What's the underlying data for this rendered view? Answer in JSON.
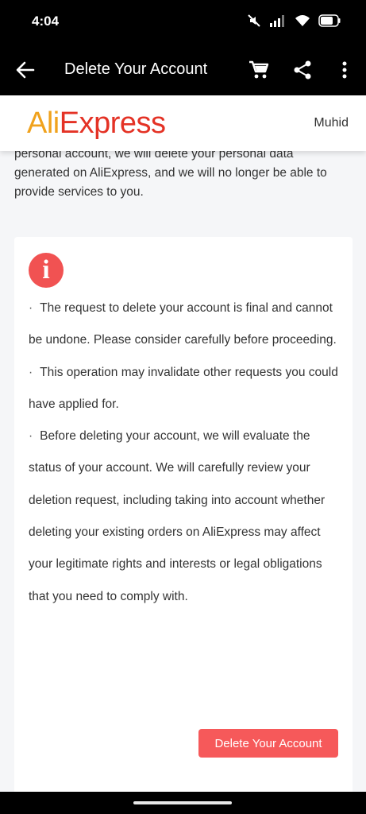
{
  "status_bar": {
    "time": "4:04"
  },
  "app_bar": {
    "title": "Delete Your Account"
  },
  "header": {
    "logo_ali": "Ali",
    "logo_express": "Express",
    "user_name": "Muhid"
  },
  "intro": {
    "text": "personal account, we will delete your personal data generated on AliExpress, and we will no longer be able to provide services to you."
  },
  "notice": {
    "bullet": "·",
    "items": [
      "The request to delete your account is final and cannot be undone. Please consider carefully before proceeding.",
      "This operation may invalidate other requests you could have applied for.",
      "Before deleting your account, we will evaluate the status of your account. We will carefully review your deletion request, including taking into account whether deleting your existing orders on AliExpress may affect your legitimate rights and interests or legal obligations that you need to comply with."
    ]
  },
  "actions": {
    "delete_label": "Delete Your Account"
  },
  "colors": {
    "accent_red": "#f6595a",
    "info_icon_red": "#f15252",
    "logo_orange": "#f0a21d",
    "logo_red": "#e43225"
  }
}
